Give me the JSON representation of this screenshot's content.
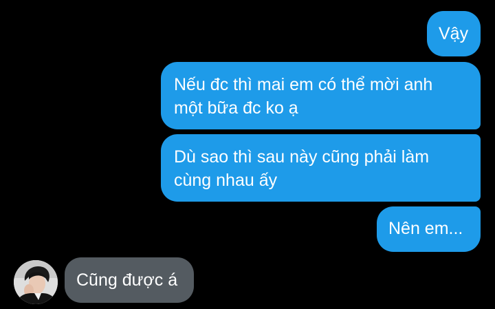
{
  "conversation": {
    "messages": [
      {
        "direction": "sent",
        "lines": [
          "Vậy"
        ]
      },
      {
        "direction": "sent",
        "lines": [
          "Nếu đc thì mai em có thể mời anh",
          "một bữa đc ko ạ"
        ]
      },
      {
        "direction": "sent",
        "lines": [
          "Dù sao thì sau này cũng phải làm",
          "cùng nhau ấy"
        ]
      },
      {
        "direction": "sent",
        "lines": [
          "Nên em..."
        ]
      },
      {
        "direction": "received",
        "lines": [
          "Cũng được á"
        ]
      }
    ],
    "contact": {
      "avatar_icon": "person-avatar-photo"
    }
  },
  "theme": {
    "background": "#000000",
    "sent_bubble": "#1e9be9",
    "received_bubble": "#545b61",
    "text": "#ffffff"
  }
}
